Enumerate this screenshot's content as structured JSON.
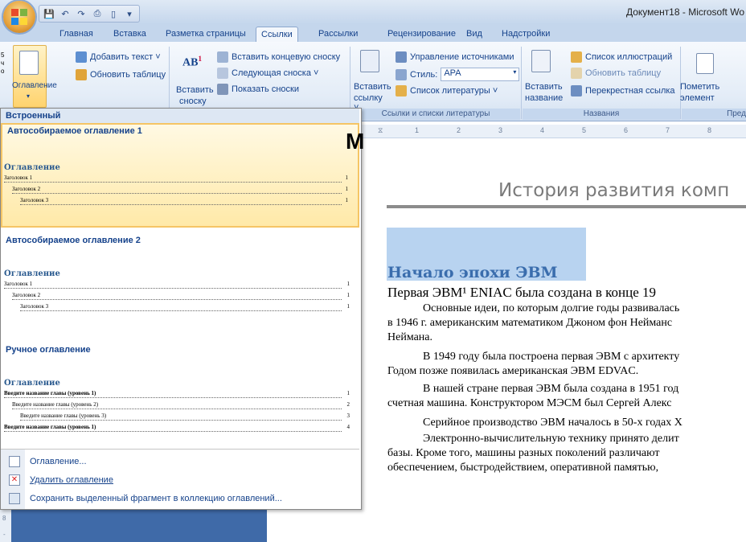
{
  "window": {
    "title": "Документ18 - Microsoft Wo"
  },
  "quick_access": {
    "icons": [
      "save-icon",
      "undo-icon",
      "redo-icon",
      "print-icon",
      "new-doc-icon",
      "customize-icon"
    ]
  },
  "tabs": [
    {
      "label": "Главная"
    },
    {
      "label": "Вставка"
    },
    {
      "label": "Разметка страницы"
    },
    {
      "label": "Ссылки",
      "active": true
    },
    {
      "label": "Рассылки"
    },
    {
      "label": "Рецензирование"
    },
    {
      "label": "Вид"
    },
    {
      "label": "Надстройки"
    }
  ],
  "ribbon": {
    "toc_group": {
      "big_button": "Оглавление",
      "add_text": "Добавить текст ˅",
      "update_table": "Обновить таблицу"
    },
    "footnotes_group": {
      "insert_footnote_line1": "Вставить",
      "insert_footnote_line2": "сноску",
      "insert_endnote": "Вставить концевую сноску",
      "next_footnote": "Следующая сноска ˅",
      "show_notes": "Показать сноски"
    },
    "citations_group": {
      "insert_citation_line1": "Вставить",
      "insert_citation_line2": "ссылку ˅",
      "manage_sources": "Управление источниками",
      "style_label": "Стиль:",
      "style_value": "APA",
      "bibliography": "Список литературы ˅",
      "group_label": "Ссылки и списки литературы"
    },
    "captions_group": {
      "insert_caption_line1": "Вставить",
      "insert_caption_line2": "название",
      "table_of_figures": "Список иллюстраций",
      "update_table": "Обновить таблицу",
      "cross_reference": "Перекрестная ссылка",
      "group_label": "Названия"
    },
    "index_group": {
      "mark_entry_line1": "Пометить",
      "mark_entry_line2": "элемент",
      "group_label": "Пред"
    }
  },
  "dropdown": {
    "section_builtin": "Встроенный",
    "items": [
      {
        "caption": "Автособираемое оглавление 1",
        "toc_title": "Оглавление",
        "lines": [
          {
            "text": "Заголовок 1",
            "num": "1"
          },
          {
            "text": "Заголовок 2",
            "num": "1"
          },
          {
            "text": "Заголовок 3",
            "num": "1"
          }
        ]
      },
      {
        "caption": "Автособираемое оглавление 2",
        "toc_title": "Оглавление",
        "lines": [
          {
            "text": "Заголовок 1",
            "num": "1"
          },
          {
            "text": "Заголовок 2",
            "num": "1"
          },
          {
            "text": "Заголовок 3",
            "num": "1"
          }
        ]
      },
      {
        "caption": "Ручное оглавление",
        "toc_title": "Оглавление",
        "lines": [
          {
            "text": "Введите название главы (уровень 1)",
            "num": "1"
          },
          {
            "text": "Введите название главы (уровень 2)",
            "num": "2"
          },
          {
            "text": "Введите название главы (уровень 3)",
            "num": "3"
          },
          {
            "text": "Введите название главы (уровень 1)",
            "num": "4"
          }
        ]
      }
    ],
    "commands": [
      {
        "label": "Оглавление..."
      },
      {
        "label": "Удалить оглавление"
      },
      {
        "label": "Сохранить выделенный фрагмент в коллекцию оглавлений..."
      }
    ]
  },
  "ruler": {
    "ticks": [
      "1",
      "2",
      "3",
      "4",
      "5",
      "6",
      "7",
      "8"
    ]
  },
  "document": {
    "heading": "История развития комп",
    "subheading": "Начало эпохи ЭВМ",
    "lines": [
      "Первая ЭВМ¹ ENIAC была  создана в конце 19",
      "Основные идеи, по которым долгие годы развивалась",
      "в 1946 г. американским математиком Джоном фон Нейманс",
      "Неймана.",
      "В 1949 году была построена первая ЭВМ с архитекту",
      "Годом позже появилась американская ЭВМ EDVAC.",
      "В нашей стране первая ЭВМ была создана в 1951 год",
      "счетная машина. Конструктором МЭСМ был Сергей Алекс",
      "Серийное производство ЭВМ началось в 50-х годах Х",
      "Электронно-вычислительную технику принято делит",
      "базы. Кроме того, машины разных поколений различают",
      "обеспечением, быстродействием, оперативной памятью,"
    ]
  },
  "left_edge": {
    "chars": [
      "5",
      "ч",
      "о"
    ],
    "big_letter": "М"
  },
  "colors": {
    "accent_blue": "#15428b",
    "selection_orange": "#f5c565",
    "heading_blue": "#3a6dad"
  }
}
